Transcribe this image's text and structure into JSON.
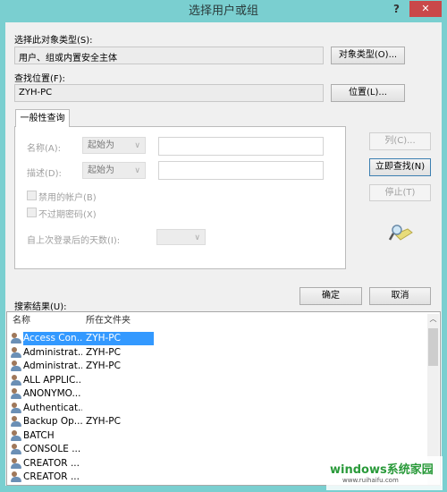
{
  "window": {
    "title": "选择用户或组",
    "help": "?",
    "close": "✕"
  },
  "object_type": {
    "label": "选择此对象类型(S):",
    "value": "用户、组或内置安全主体",
    "button": "对象类型(O)..."
  },
  "location": {
    "label": "查找位置(F):",
    "value": "ZYH-PC",
    "button": "位置(L)..."
  },
  "tab": {
    "label": "一般性查询"
  },
  "query": {
    "name_label": "名称(A):",
    "name_mode": "起始为",
    "name_value": "",
    "desc_label": "描述(D):",
    "desc_mode": "起始为",
    "desc_value": "",
    "disabled_accounts": "禁用的帐户(B)",
    "non_expiring": "不过期密码(X)",
    "days_label": "自上次登录后的天数(I):",
    "days_value": ""
  },
  "buttons": {
    "columns": "列(C)...",
    "find_now": "立即查找(N)",
    "stop": "停止(T)",
    "ok": "确定",
    "cancel": "取消"
  },
  "results": {
    "label": "搜索结果(U):",
    "columns": [
      "名称",
      "所在文件夹"
    ],
    "rows": [
      {
        "name": "Access Con...",
        "folder": "ZYH-PC",
        "selected": true
      },
      {
        "name": "Administrat...",
        "folder": "ZYH-PC"
      },
      {
        "name": "Administrat...",
        "folder": "ZYH-PC"
      },
      {
        "name": "ALL APPLIC...",
        "folder": ""
      },
      {
        "name": "ANONYMO...",
        "folder": ""
      },
      {
        "name": "Authenticat...",
        "folder": ""
      },
      {
        "name": "Backup Op...",
        "folder": "ZYH-PC"
      },
      {
        "name": "BATCH",
        "folder": ""
      },
      {
        "name": "CONSOLE ...",
        "folder": ""
      },
      {
        "name": "CREATOR ...",
        "folder": ""
      },
      {
        "name": "CREATOR ...",
        "folder": ""
      }
    ]
  },
  "watermark": {
    "brand": "windows系统家园",
    "url": "www.ruihaifu.com"
  },
  "colors": {
    "frame": "#7acfd0",
    "selection": "#3399ff",
    "close": "#c9484a"
  }
}
